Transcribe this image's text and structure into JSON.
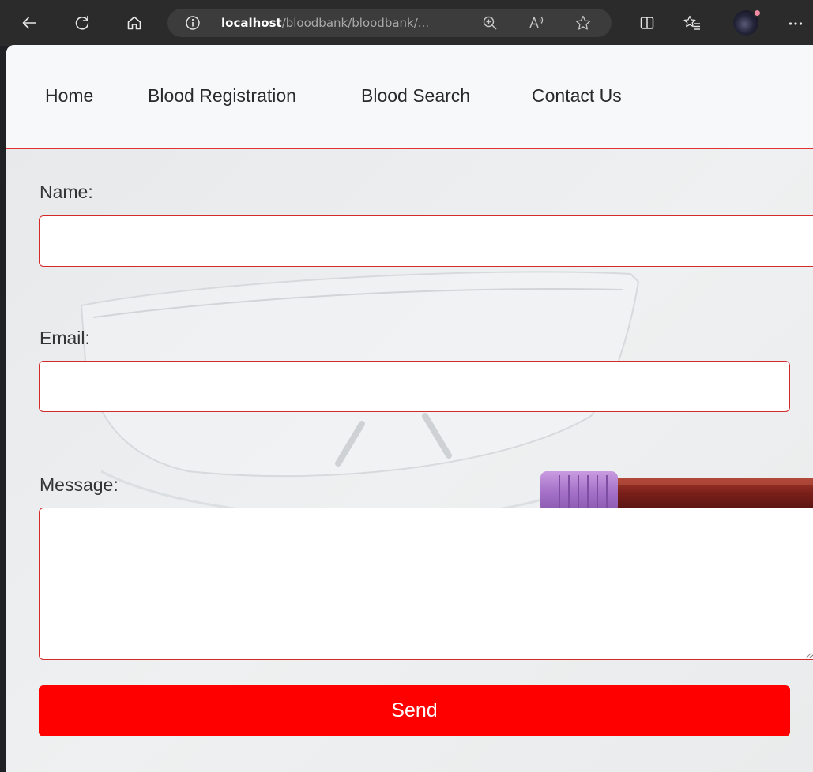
{
  "browser": {
    "url_host": "localhost",
    "url_path": "/bloodbank/bloodbank/..."
  },
  "nav": {
    "items": [
      {
        "label": "Home"
      },
      {
        "label": "Blood Registration"
      },
      {
        "label": "Blood Search"
      },
      {
        "label": "Contact Us"
      }
    ]
  },
  "form": {
    "name_label": "Name:",
    "name_value": "",
    "email_label": "Email:",
    "email_value": "",
    "message_label": "Message:",
    "message_value": "",
    "send_label": "Send"
  },
  "icons": {
    "back": "back-arrow-icon",
    "refresh": "refresh-icon",
    "home": "home-icon",
    "site_info": "info-icon",
    "zoom": "zoom-in-icon",
    "read_aloud": "read-aloud-icon",
    "favorite": "star-icon",
    "split_screen": "split-screen-icon",
    "favorites_bar": "favorites-icon",
    "profile": "avatar",
    "more": "more-icon"
  },
  "colors": {
    "accent_red": "#ff0000",
    "border_red": "#d42a2a",
    "browser_bg": "#2b2b2b",
    "address_bg": "#3c3c3c",
    "nav_bg": "#f7f8f9",
    "page_bg": "#eceeef"
  }
}
